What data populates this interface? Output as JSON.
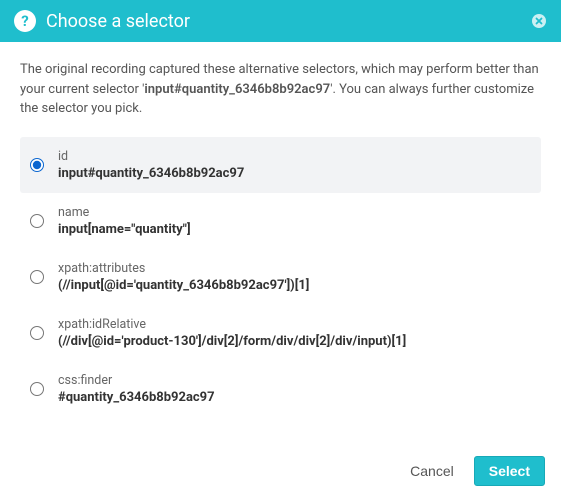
{
  "header": {
    "title": "Choose a selector"
  },
  "description": {
    "prefix": "The original recording captured these alternative selectors, which may perform better than your current selector '",
    "current": "input#quantity_6346b8b92ac97",
    "suffix": "'. You can always further customize the selector you pick."
  },
  "options": [
    {
      "type": "id",
      "value": "input#quantity_6346b8b92ac97",
      "selected": true
    },
    {
      "type": "name",
      "value": "input[name=\"quantity\"]",
      "selected": false
    },
    {
      "type": "xpath:attributes",
      "value": "(//input[@id='quantity_6346b8b92ac97'])[1]",
      "selected": false
    },
    {
      "type": "xpath:idRelative",
      "value": "(//div[@id='product-130']/div[2]/form/div/div[2]/div/input)[1]",
      "selected": false
    },
    {
      "type": "css:finder",
      "value": "#quantity_6346b8b92ac97",
      "selected": false
    }
  ],
  "footer": {
    "cancel": "Cancel",
    "select": "Select"
  }
}
